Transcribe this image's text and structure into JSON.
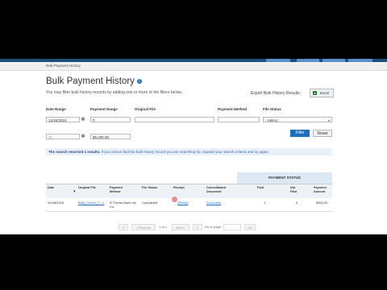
{
  "breadcrumb": "Bulk Payment History",
  "page": {
    "title": "Bulk Payment History",
    "description": "You may filter bulk history records by adding one or more of the filters below."
  },
  "export": {
    "label": "Export Bulk History Results:",
    "excel_label": "Excel"
  },
  "filters": {
    "date_range_label": "Date Range",
    "date_from": "12/30/2015",
    "date_to_placeholder": "To",
    "payment_range_label": "Payment Range",
    "payment_min": "0",
    "payment_max": "$5,000.00",
    "original_file_label": "Original File",
    "payment_method_label": "Payment Method",
    "file_status_label": "File Status",
    "file_status_value": "- Select -",
    "filter_button": "Filter",
    "reset_button": "Reset"
  },
  "results": {
    "count_text": "The search returned 1 results.",
    "hint_text": "If you cannot find the bulk history record you are searching for, expand your search criteria and try again."
  },
  "table": {
    "payment_status_header": "PAYMENT STATUS",
    "columns": {
      "date": "Date",
      "original_file": "Original File",
      "payment_method": "Payment Method",
      "file_status": "File Status",
      "receipt": "Receipt",
      "consolidated_document": "Consolidated Document",
      "paid": "Paid",
      "not_paid": "Not Paid",
      "payment_amount": "Payment Amount"
    },
    "rows": [
      {
        "date": "01/08/2016",
        "original_file": "Bulk_Comm_C...v",
        "payment_method": "IF Forms Bank Ins Co.",
        "file_status": "Completed",
        "receipt": "Receipt",
        "consolidated_document": "Document",
        "paid": "1",
        "not_paid": "0",
        "payment_amount": "$900.00"
      }
    ]
  },
  "pagination": {
    "first": "«",
    "prev": "‹ Previous",
    "page_info": "1 of 1",
    "next": "Next ›",
    "last": "»",
    "go_to_page_label": "Go to page:",
    "go_button": "Go"
  },
  "colors": {
    "brand": "#1f4e79",
    "primary_button": "#1f6fbf",
    "excel_icon": "#2e7d32",
    "result_bar": "#e9f0f7"
  },
  "icons": {
    "info": "info-icon",
    "calendar": "calendar-icon",
    "excel": "excel-icon",
    "sort": "sort-icon"
  }
}
